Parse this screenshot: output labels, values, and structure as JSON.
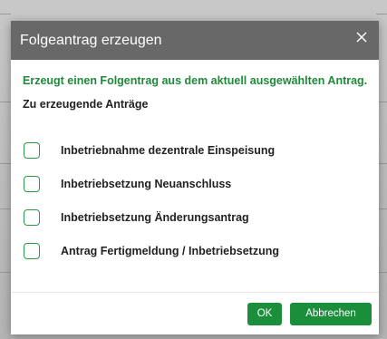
{
  "dialog": {
    "title": "Folgeantrag erzeugen",
    "description": "Erzeugt einen Folgentrag aus dem aktuell ausgewählten Antrag.",
    "section_label": "Zu erzeugende Anträge",
    "options": [
      {
        "label": "Inbetriebnahme dezentrale Einspeisung",
        "checked": false
      },
      {
        "label": "Inbetriebsetzung Neuanschluss",
        "checked": false
      },
      {
        "label": "Inbetriebsetzung Änderungsantrag",
        "checked": false
      },
      {
        "label": "Antrag Fertigmeldung / Inbetriebsetzung",
        "checked": false
      }
    ],
    "buttons": {
      "ok_label": "OK",
      "cancel_label": "Abbrechen"
    }
  },
  "colors": {
    "header_bg": "#686868",
    "accent_green": "#1a8e3b",
    "description_text": "#1e8a3a",
    "checkbox_border": "#2a9a49"
  },
  "icons": {
    "close": "close-icon"
  }
}
